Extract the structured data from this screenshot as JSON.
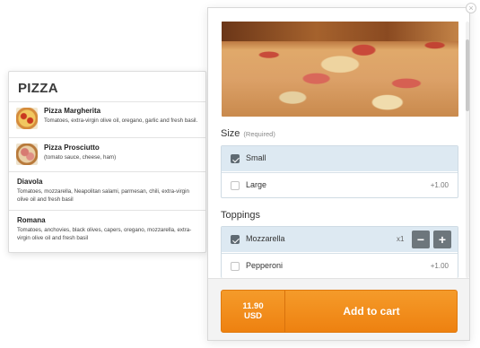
{
  "menu": {
    "title": "PIZZA",
    "items": [
      {
        "name": "Pizza Margherita",
        "description": "Tomatoes, extra-virgin olive oil, oregano, garlic and fresh basil."
      },
      {
        "name": "Pizza Prosciutto",
        "description": "(tomato sauce, cheese, ham)"
      },
      {
        "name": "Diavola",
        "description": "Tomatoes, mozzarella, Neapolitan salami, parmesan, chili, extra-virgin olive oil and fresh basil"
      },
      {
        "name": "Romana",
        "description": "Tomatoes, anchovies, black olives, capers, oregano, mozzarella, extra-virgin olive oil and fresh basil"
      }
    ]
  },
  "product": {
    "close_glyph": "×",
    "size": {
      "label": "Size",
      "required": "(Required)",
      "options": [
        {
          "label": "Small",
          "checked": true,
          "price": ""
        },
        {
          "label": "Large",
          "checked": false,
          "price": "+1.00"
        }
      ]
    },
    "toppings": {
      "label": "Toppings",
      "options": [
        {
          "label": "Mozzarella",
          "checked": true,
          "quantity": "x1",
          "minus": "−",
          "plus": "+"
        },
        {
          "label": "Pepperoni",
          "checked": false,
          "price": "+1.00"
        }
      ]
    },
    "cart": {
      "price": "11.90",
      "currency": "USD",
      "label": "Add to cart"
    }
  },
  "colors": {
    "accent": "#ee8110",
    "selected_row": "#dde9f2"
  }
}
